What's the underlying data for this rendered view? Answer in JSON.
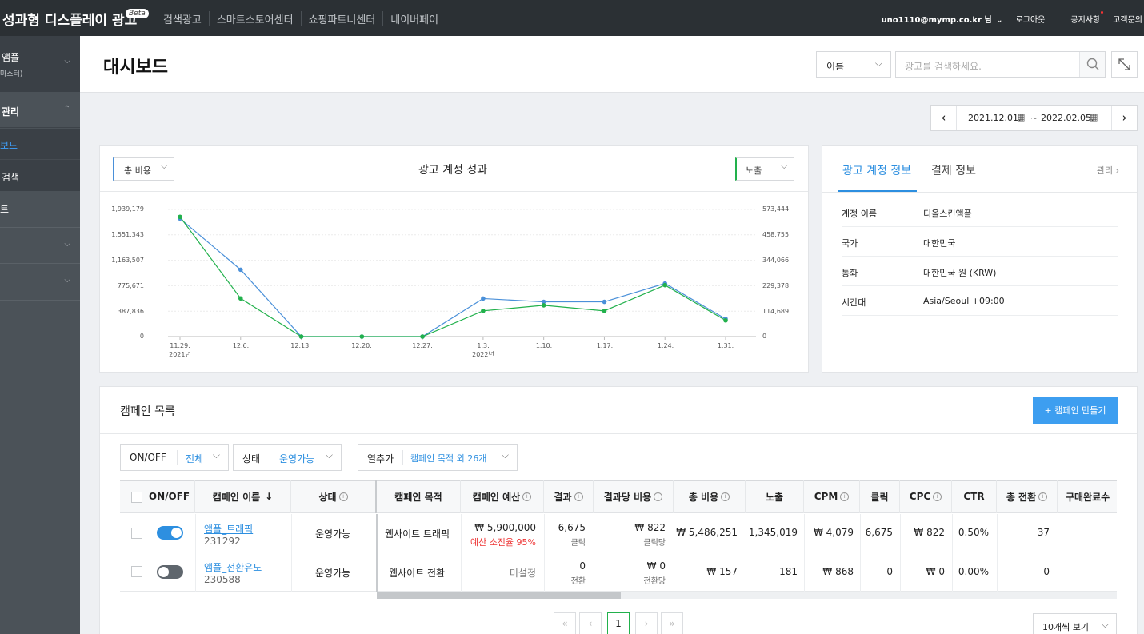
{
  "topbar": {
    "brand": "성과형 디스플레이 광고",
    "beta": "Beta",
    "nav": [
      "검색광고",
      "스마트스토어센터",
      "쇼핑파트너센터",
      "네이버페이"
    ],
    "user": "uno1110@mymp.co.kr 님",
    "logout": "로그아웃",
    "notice": "공지사항",
    "support": "고객문의"
  },
  "sidebar": {
    "account_name": "앰플",
    "account_role": "마스터)",
    "section": "관리",
    "items": [
      "보드",
      "검색",
      "트"
    ]
  },
  "header": {
    "title": "대시보드",
    "search_type": "이름",
    "search_placeholder": "광고를 검색하세요."
  },
  "date_range": {
    "start": "2021.12.01.",
    "sep": "~",
    "end": "2022.02.05."
  },
  "performance": {
    "title": "광고 계정 성과",
    "left_metric": "총 비용",
    "right_metric": "노출",
    "left_color": "#4a90d9",
    "right_color": "#22b14c"
  },
  "chart_data": {
    "type": "line",
    "title": "광고 계정 성과",
    "x": [
      "11.29.",
      "12.6.",
      "12.13.",
      "12.20.",
      "12.27.",
      "1.3.",
      "1.10.",
      "1.17.",
      "1.24.",
      "1.31."
    ],
    "x_sub": [
      "2021년",
      "",
      "",
      "",
      "",
      "2022년",
      "",
      "",
      "",
      ""
    ],
    "y_left_ticks": [
      "1,939,179",
      "1,551,343",
      "1,163,507",
      "775,671",
      "387,836",
      "0"
    ],
    "y_right_ticks": [
      "573,444",
      "458,755",
      "344,066",
      "229,378",
      "114,689",
      "0"
    ],
    "ylim_left": [
      0,
      1939179
    ],
    "ylim_right": [
      0,
      573444
    ],
    "series": [
      {
        "name": "총 비용",
        "axis": "left",
        "color": "#4a90d9",
        "values": [
          1800000,
          1020000,
          0,
          0,
          0,
          580000,
          530000,
          530000,
          810000,
          270000
        ]
      },
      {
        "name": "노출",
        "axis": "right",
        "color": "#22b14c",
        "values": [
          540000,
          172000,
          0,
          0,
          0,
          116000,
          141000,
          116000,
          232000,
          73000
        ]
      }
    ]
  },
  "account_info": {
    "tab_active": "광고 계정 정보",
    "tab_other": "결제 정보",
    "manage": "관리",
    "rows": [
      {
        "k": "계정 이름",
        "v": "디올스킨앰플"
      },
      {
        "k": "국가",
        "v": "대한민국"
      },
      {
        "k": "통화",
        "v": "대한민국 원 (KRW)"
      },
      {
        "k": "시간대",
        "v": "Asia/Seoul +09:00"
      }
    ]
  },
  "campaigns": {
    "title": "캠페인 목록",
    "create": "+ 캠페인 만들기",
    "filters": {
      "onoff_label": "ON/OFF",
      "onoff_value": "전체",
      "status_label": "상태",
      "status_value": "운영가능",
      "cols_label": "열추가",
      "cols_value": "캠페인 목적 외 26개"
    },
    "headers": [
      "ON/OFF",
      "캠페인 이름",
      "상태",
      "캠페인 목적",
      "캠페인 예산",
      "결과",
      "결과당 비용",
      "총 비용",
      "노출",
      "CPM",
      "클릭",
      "CPC",
      "CTR",
      "총 전환",
      "구매완료수"
    ],
    "rows": [
      {
        "on": true,
        "name": "앰플_트래픽",
        "id": "231292",
        "status": "운영가능",
        "purpose": "웹사이트 트래픽",
        "budget": "₩ 5,900,000",
        "budget_note": "예산 소진율 95%",
        "result": "6,675",
        "result_unit": "클릭",
        "cpr": "₩ 822",
        "cpr_unit": "클릭당",
        "cost": "₩ 5,486,251",
        "imp": "1,345,019",
        "cpm": "₩ 4,079",
        "clicks": "6,675",
        "cpc": "₩ 822",
        "ctr": "0.50%",
        "conv": "37"
      },
      {
        "on": false,
        "name": "앰플_전환유도",
        "id": "230588",
        "status": "운영가능",
        "purpose": "웹사이트 전환",
        "budget": "미설정",
        "budget_note": "",
        "result": "0",
        "result_unit": "전환",
        "cpr": "₩ 0",
        "cpr_unit": "전환당",
        "cost": "₩ 157",
        "imp": "181",
        "cpm": "₩ 868",
        "clicks": "0",
        "cpc": "₩ 0",
        "ctr": "0.00%",
        "conv": "0"
      }
    ],
    "page": "1",
    "per_page": "10개씩 보기"
  }
}
